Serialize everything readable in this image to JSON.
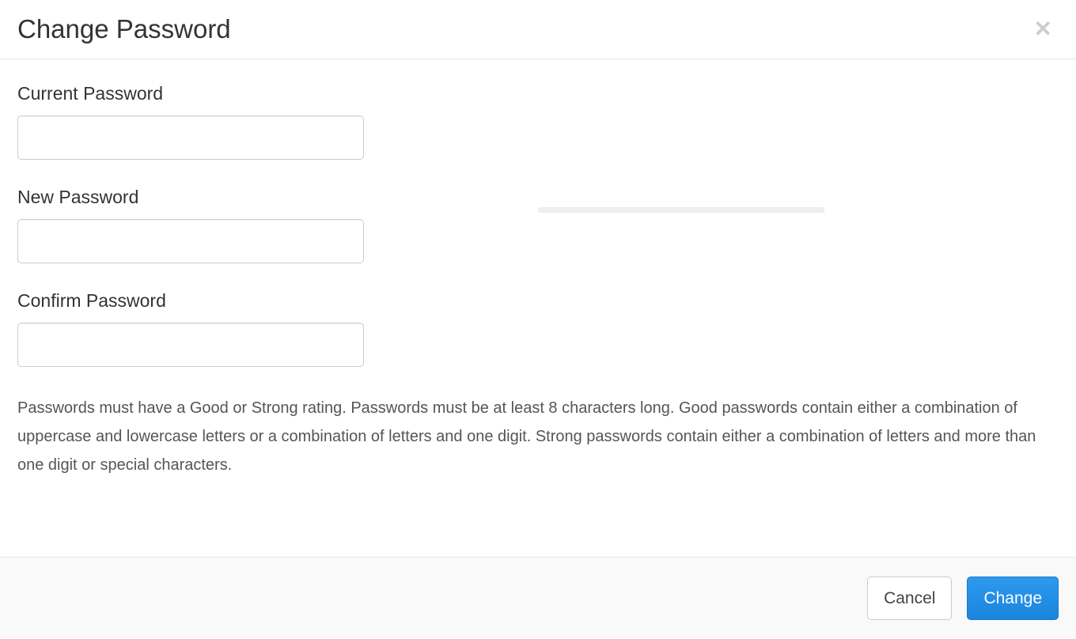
{
  "header": {
    "title": "Change Password"
  },
  "form": {
    "current_password": {
      "label": "Current Password",
      "value": ""
    },
    "new_password": {
      "label": "New Password",
      "value": ""
    },
    "confirm_password": {
      "label": "Confirm Password",
      "value": ""
    },
    "help_text": "Passwords must have a Good or Strong rating. Passwords must be at least 8 characters long. Good passwords contain either a combination of uppercase and lowercase letters or a combination of letters and one digit. Strong passwords contain either a combination of letters and more than one digit or special characters."
  },
  "footer": {
    "cancel_label": "Cancel",
    "change_label": "Change"
  }
}
